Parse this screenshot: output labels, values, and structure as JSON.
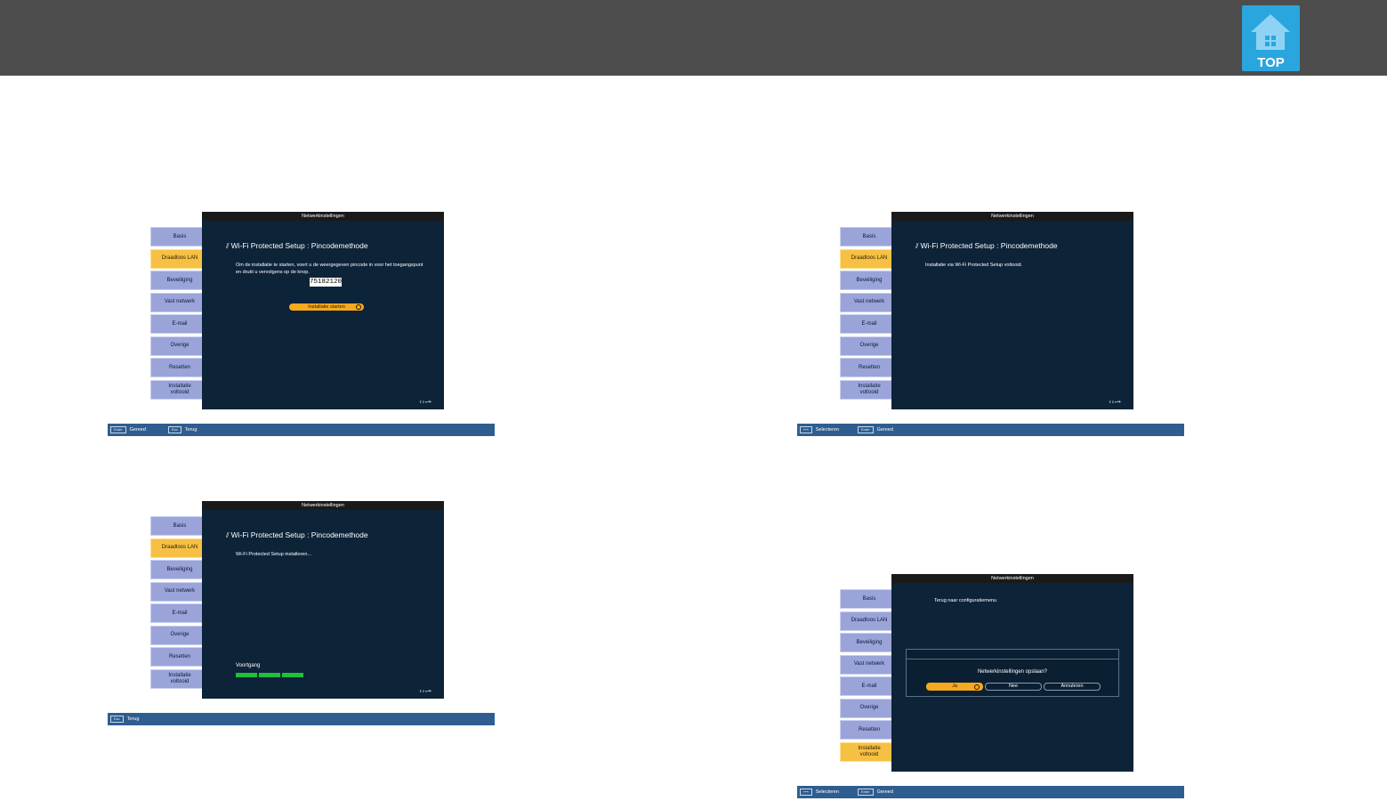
{
  "header": {
    "top_button_label": "TOP",
    "accent": "#2aa6df"
  },
  "screens": {
    "s1": {
      "title": "Netwerkinstellingen",
      "menu": [
        "Basis",
        "Draadloos LAN",
        "Beveiliging",
        "Vast netwerk",
        "E-mail",
        "Overige",
        "Resetten",
        "Installatie\nvoltooid"
      ],
      "active_index": 1,
      "heading": "Wi-Fi Protected Setup : Pincodemethode",
      "text": "Om de installatie te starten, voert u de weergegeven pincode in voor het toegangspunt en drukt u vervolgens op de knop.",
      "pin": "75182120",
      "button": "Installatie starten",
      "fine": "⬆⬇⬅⮕",
      "bar": [
        {
          "key": "Enter",
          "label": "Gereed"
        },
        {
          "key": "Esc",
          "label": "Terug"
        }
      ]
    },
    "s2": {
      "title": "Netwerkinstellingen",
      "menu": [
        "Basis",
        "Draadloos LAN",
        "Beveiliging",
        "Vast netwerk",
        "E-mail",
        "Overige",
        "Resetten",
        "Installatie\nvoltooid"
      ],
      "active_index": 1,
      "heading": "Wi-Fi Protected Setup : Pincodemethode",
      "text": "Installatie via Wi-Fi Protected Setup voltooid.",
      "fine": "⬆⬇⬅⮕",
      "bar": [
        {
          "key": "⟷",
          "label": "Selecteren"
        },
        {
          "key": "Enter",
          "label": "Gereed"
        }
      ]
    },
    "s3": {
      "title": "Netwerkinstellingen",
      "menu": [
        "Basis",
        "Draadloos LAN",
        "Beveiliging",
        "Vast netwerk",
        "E-mail",
        "Overige",
        "Resetten",
        "Installatie\nvoltooid"
      ],
      "active_index": 1,
      "heading": "Wi-Fi Protected Setup : Pincodemethode",
      "text": "Wi-Fi Protected Setup installeren...",
      "progress_label": "Voortgang",
      "progress_segments": 3,
      "fine": "⬆⬇⬅⮕",
      "bar": [
        {
          "key": "Esc",
          "label": "Terug"
        }
      ]
    },
    "s4": {
      "title": "Netwerkinstellingen",
      "menu": [
        "Basis",
        "Draadloos LAN",
        "Beveiliging",
        "Vast netwerk",
        "E-mail",
        "Overige",
        "Resetten",
        "Installatie\nvoltooid"
      ],
      "active_index": 7,
      "text": "Terug naar configuratiemenu",
      "dialog_question": "Netwerkinstellingen opslaan?",
      "dialog_buttons": [
        "Ja",
        "Nee",
        "Annuleren"
      ],
      "bar": [
        {
          "key": "⟷",
          "label": "Selecteren"
        },
        {
          "key": "Enter",
          "label": "Gereed"
        }
      ]
    }
  }
}
